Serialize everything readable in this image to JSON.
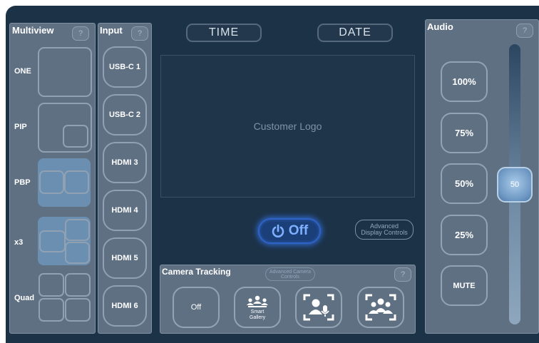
{
  "multiview": {
    "title": "Multiview",
    "help": "?",
    "rows": [
      {
        "label": "ONE"
      },
      {
        "label": "PIP"
      },
      {
        "label": "PBP"
      },
      {
        "label": "x3"
      },
      {
        "label": "Quad"
      }
    ]
  },
  "input": {
    "title": "Input",
    "help": "?",
    "buttons": [
      "USB-C 1",
      "USB-C 2",
      "HDMI 3",
      "HDMI 4",
      "HDMI 5",
      "HDMI 6"
    ]
  },
  "header": {
    "time": "TIME",
    "date": "DATE"
  },
  "display": {
    "logo_text": "Customer Logo",
    "power_label": "Off",
    "advanced_display": "Advanced Display Controls"
  },
  "camera_tracking": {
    "title": "Camera Tracking",
    "advanced_camera": "Advanced Camera Controls",
    "help": "?",
    "buttons": [
      {
        "label": "Off",
        "icon": "off-text"
      },
      {
        "label": "Smart Gallery",
        "icon": "smart-gallery-icon"
      },
      {
        "label": "",
        "icon": "speaker-tracking-icon"
      },
      {
        "label": "",
        "icon": "group-framing-icon"
      }
    ]
  },
  "audio": {
    "title": "Audio",
    "help": "?",
    "presets": [
      "100%",
      "75%",
      "50%",
      "25%",
      "MUTE"
    ],
    "slider_value": "50",
    "level_fraction": 0.5
  },
  "colors": {
    "background": "#1c3247",
    "panel": "#5f7083",
    "power_glow": "#2f67c8",
    "power_text": "#7fb0ff"
  }
}
